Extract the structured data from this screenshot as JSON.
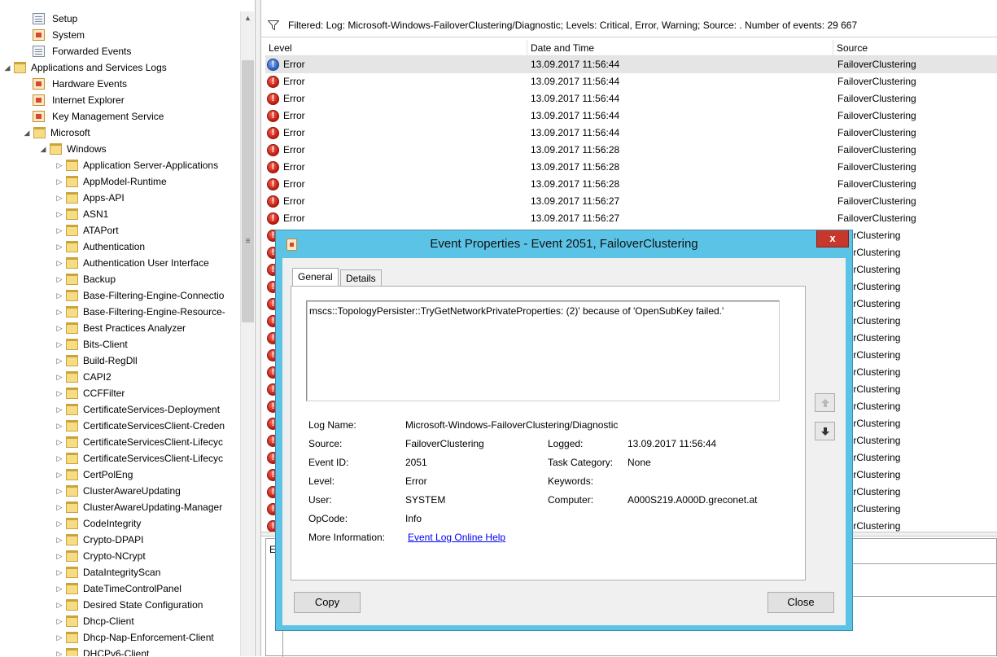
{
  "tree": {
    "items": [
      {
        "label": "Setup",
        "icon": "log-icon",
        "expander": ""
      },
      {
        "label": "System",
        "icon": "event-log-icon",
        "expander": ""
      },
      {
        "label": "Forwarded Events",
        "icon": "log-icon",
        "expander": ""
      },
      {
        "label": "Applications and Services Logs",
        "icon": "folder-icon",
        "expander": "◢"
      },
      {
        "label": "Hardware Events",
        "icon": "event-log-icon",
        "expander": ""
      },
      {
        "label": "Internet Explorer",
        "icon": "event-log-icon",
        "expander": ""
      },
      {
        "label": "Key Management Service",
        "icon": "event-log-icon",
        "expander": ""
      },
      {
        "label": "Microsoft",
        "icon": "folder-icon",
        "expander": "◢"
      },
      {
        "label": "Windows",
        "icon": "folder-icon",
        "expander": "◢"
      },
      {
        "label": "Application Server-Applications",
        "icon": "folder-icon",
        "expander": "▷"
      },
      {
        "label": "AppModel-Runtime",
        "icon": "folder-icon",
        "expander": "▷"
      },
      {
        "label": "Apps-API",
        "icon": "folder-icon",
        "expander": "▷"
      },
      {
        "label": "ASN1",
        "icon": "folder-icon",
        "expander": "▷"
      },
      {
        "label": "ATAPort",
        "icon": "folder-icon",
        "expander": "▷"
      },
      {
        "label": "Authentication",
        "icon": "folder-icon",
        "expander": "▷"
      },
      {
        "label": "Authentication User Interface",
        "icon": "folder-icon",
        "expander": "▷"
      },
      {
        "label": "Backup",
        "icon": "folder-icon",
        "expander": "▷"
      },
      {
        "label": "Base-Filtering-Engine-Connectio",
        "icon": "folder-icon",
        "expander": "▷"
      },
      {
        "label": "Base-Filtering-Engine-Resource-",
        "icon": "folder-icon",
        "expander": "▷"
      },
      {
        "label": "Best Practices Analyzer",
        "icon": "folder-icon",
        "expander": "▷"
      },
      {
        "label": "Bits-Client",
        "icon": "folder-icon",
        "expander": "▷"
      },
      {
        "label": "Build-RegDll",
        "icon": "folder-icon",
        "expander": "▷"
      },
      {
        "label": "CAPI2",
        "icon": "folder-icon",
        "expander": "▷"
      },
      {
        "label": "CCFFilter",
        "icon": "folder-icon",
        "expander": "▷"
      },
      {
        "label": "CertificateServices-Deployment",
        "icon": "folder-icon",
        "expander": "▷"
      },
      {
        "label": "CertificateServicesClient-Creden",
        "icon": "folder-icon",
        "expander": "▷"
      },
      {
        "label": "CertificateServicesClient-Lifecyc",
        "icon": "folder-icon",
        "expander": "▷"
      },
      {
        "label": "CertificateServicesClient-Lifecyc",
        "icon": "folder-icon",
        "expander": "▷"
      },
      {
        "label": "CertPolEng",
        "icon": "folder-icon",
        "expander": "▷"
      },
      {
        "label": "ClusterAwareUpdating",
        "icon": "folder-icon",
        "expander": "▷"
      },
      {
        "label": "ClusterAwareUpdating-Manager",
        "icon": "folder-icon",
        "expander": "▷"
      },
      {
        "label": "CodeIntegrity",
        "icon": "folder-icon",
        "expander": "▷"
      },
      {
        "label": "Crypto-DPAPI",
        "icon": "folder-icon",
        "expander": "▷"
      },
      {
        "label": "Crypto-NCrypt",
        "icon": "folder-icon",
        "expander": "▷"
      },
      {
        "label": "DataIntegrityScan",
        "icon": "folder-icon",
        "expander": "▷"
      },
      {
        "label": "DateTimeControlPanel",
        "icon": "folder-icon",
        "expander": "▷"
      },
      {
        "label": "Desired State Configuration",
        "icon": "folder-icon",
        "expander": "▷"
      },
      {
        "label": "Dhcp-Client",
        "icon": "folder-icon",
        "expander": "▷"
      },
      {
        "label": "Dhcp-Nap-Enforcement-Client",
        "icon": "folder-icon",
        "expander": "▷"
      },
      {
        "label": "DHCPv6-Client",
        "icon": "folder-icon",
        "expander": "▷"
      }
    ]
  },
  "filter": {
    "text": "Filtered: Log: Microsoft-Windows-FailoverClustering/Diagnostic; Levels: Critical, Error, Warning; Source: . Number of events: 29 667"
  },
  "columns": {
    "level": "Level",
    "date": "Date and Time",
    "source": "Source"
  },
  "events": [
    {
      "level": "Error",
      "date": "13.09.2017 11:56:44",
      "source": "FailoverClustering",
      "selected": true
    },
    {
      "level": "Error",
      "date": "13.09.2017 11:56:44",
      "source": "FailoverClustering"
    },
    {
      "level": "Error",
      "date": "13.09.2017 11:56:44",
      "source": "FailoverClustering"
    },
    {
      "level": "Error",
      "date": "13.09.2017 11:56:44",
      "source": "FailoverClustering"
    },
    {
      "level": "Error",
      "date": "13.09.2017 11:56:44",
      "source": "FailoverClustering"
    },
    {
      "level": "Error",
      "date": "13.09.2017 11:56:28",
      "source": "FailoverClustering"
    },
    {
      "level": "Error",
      "date": "13.09.2017 11:56:28",
      "source": "FailoverClustering"
    },
    {
      "level": "Error",
      "date": "13.09.2017 11:56:28",
      "source": "FailoverClustering"
    },
    {
      "level": "Error",
      "date": "13.09.2017 11:56:27",
      "source": "FailoverClustering"
    },
    {
      "level": "Error",
      "date": "13.09.2017 11:56:27",
      "source": "FailoverClustering"
    },
    {
      "level": "",
      "date": "",
      "source": "overClustering"
    },
    {
      "level": "",
      "date": "",
      "source": "overClustering"
    },
    {
      "level": "",
      "date": "",
      "source": "overClustering"
    },
    {
      "level": "",
      "date": "",
      "source": "overClustering"
    },
    {
      "level": "",
      "date": "",
      "source": "overClustering"
    },
    {
      "level": "",
      "date": "",
      "source": "overClustering"
    },
    {
      "level": "",
      "date": "",
      "source": "overClustering"
    },
    {
      "level": "",
      "date": "",
      "source": "overClustering"
    },
    {
      "level": "",
      "date": "",
      "source": "overClustering"
    },
    {
      "level": "",
      "date": "",
      "source": "overClustering"
    },
    {
      "level": "",
      "date": "",
      "source": "overClustering"
    },
    {
      "level": "",
      "date": "",
      "source": "overClustering"
    },
    {
      "level": "",
      "date": "",
      "source": "overClustering"
    },
    {
      "level": "",
      "date": "",
      "source": "overClustering"
    },
    {
      "level": "",
      "date": "",
      "source": "overClustering"
    },
    {
      "level": "",
      "date": "",
      "source": "overClustering"
    },
    {
      "level": "",
      "date": "",
      "source": "overClustering"
    },
    {
      "level": "",
      "date": "",
      "source": "overClustering"
    }
  ],
  "preview": {
    "tab_stub": "E"
  },
  "dialog": {
    "title": "Event Properties - Event 2051, FailoverClustering",
    "close_glyph": "x",
    "tabs": [
      "General",
      "Details"
    ],
    "description": "mscs::TopologyPersister::TryGetNetworkPrivateProperties: (2)' because of 'OpenSubKey failed.'",
    "fields": {
      "log_name_label": "Log Name:",
      "log_name": "Microsoft-Windows-FailoverClustering/Diagnostic",
      "source_label": "Source:",
      "source": "FailoverClustering",
      "logged_label": "Logged:",
      "logged": "13.09.2017 11:56:44",
      "event_id_label": "Event ID:",
      "event_id": "2051",
      "task_category_label": "Task Category:",
      "task_category": "None",
      "level_label": "Level:",
      "level": "Error",
      "keywords_label": "Keywords:",
      "keywords": "",
      "user_label": "User:",
      "user": "SYSTEM",
      "computer_label": "Computer:",
      "computer": "A000S219.A000D.greconet.at",
      "opcode_label": "OpCode:",
      "opcode": "Info",
      "more_info_label": "More Information:",
      "more_info_link": "Event Log Online Help"
    },
    "buttons": {
      "copy": "Copy",
      "close": "Close"
    }
  },
  "colors": {
    "dialog_frame": "#5bc3e6",
    "close_button": "#c7372c",
    "error_icon": "#c4170c",
    "link": "#0000ee"
  }
}
